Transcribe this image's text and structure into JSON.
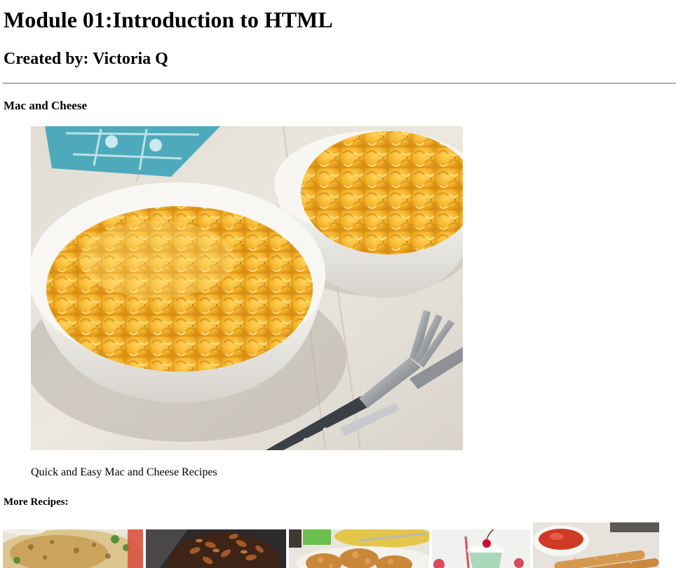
{
  "header": {
    "title": "Module 01:Introduction to HTML",
    "subtitle": "Created by: Victoria Q"
  },
  "main": {
    "recipe_heading": "Mac and Cheese",
    "image_subject": "mac-and-cheese-bowls",
    "caption": "Quick and Easy Mac and Cheese Recipes",
    "more_heading": "More Recipes:"
  },
  "more_recipes": [
    {
      "subject": "casserole"
    },
    {
      "subject": "pecan-brownies"
    },
    {
      "subject": "fried-chicken"
    },
    {
      "subject": "mint-milkshake"
    },
    {
      "subject": "mozzarella-sticks"
    }
  ],
  "colors": {
    "rule": "#7a7a7a",
    "text": "#000000",
    "background": "#ffffff"
  }
}
